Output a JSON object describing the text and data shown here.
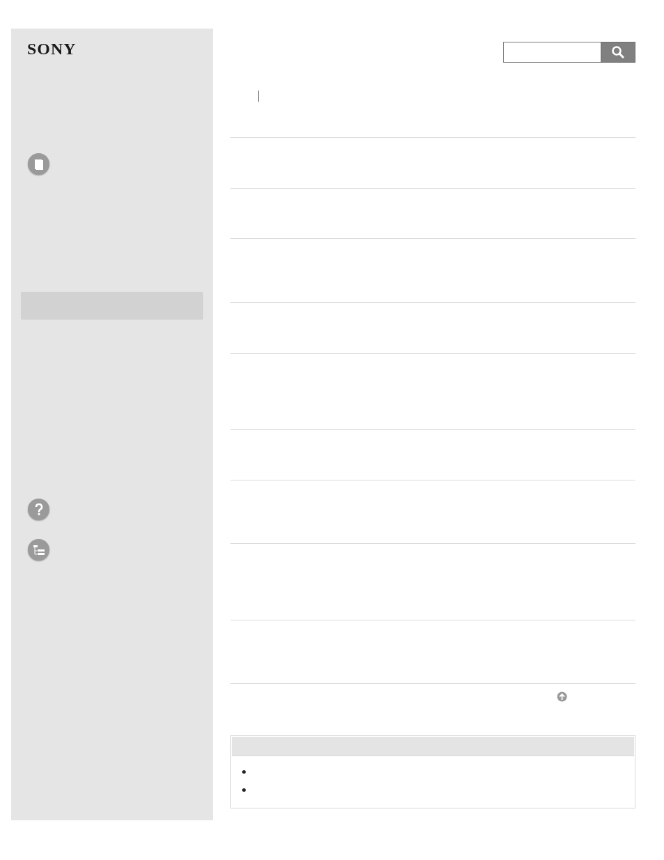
{
  "header": {
    "logo": "SONY"
  }
}
